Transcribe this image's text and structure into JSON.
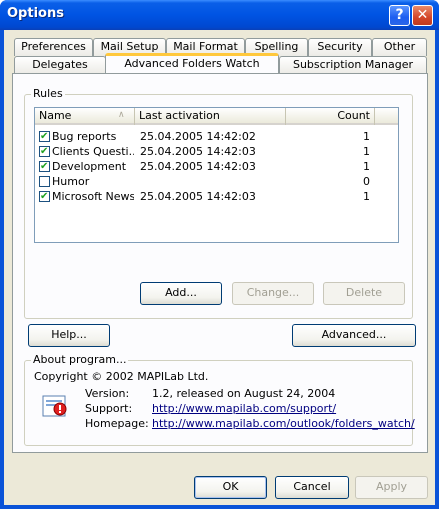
{
  "window": {
    "title": "Options"
  },
  "tabs_row1": [
    "Preferences",
    "Mail Setup",
    "Mail Format",
    "Spelling",
    "Security",
    "Other"
  ],
  "tabs_row2": [
    "Delegates",
    "Advanced Folders Watch",
    "Subscription Manager"
  ],
  "selected_tab": "Advanced Folders Watch",
  "rules": {
    "group_label": "Rules",
    "columns": {
      "name": "Name",
      "last_activation": "Last activation",
      "count": "Count"
    },
    "rows": [
      {
        "checked": true,
        "name": "Bug reports",
        "last_activation": "25.04.2005 14:42:02",
        "count": "1"
      },
      {
        "checked": true,
        "name": "Clients Questi...",
        "last_activation": "25.04.2005 14:42:03",
        "count": "1"
      },
      {
        "checked": true,
        "name": "Development",
        "last_activation": "25.04.2005 14:42:03",
        "count": "1"
      },
      {
        "checked": false,
        "name": "Humor",
        "last_activation": "",
        "count": "0"
      },
      {
        "checked": true,
        "name": "Microsoft News",
        "last_activation": "25.04.2005 14:42:03",
        "count": "1"
      }
    ],
    "add_label": "Add...",
    "change_label": "Change...",
    "delete_label": "Delete"
  },
  "help_label": "Help...",
  "advanced_label": "Advanced...",
  "about": {
    "group_label": "About program...",
    "copyright": "Copyright © 2002 MAPILab Ltd.",
    "version_label": "Version:",
    "version_value": "1.2, released on August 24, 2004",
    "support_label": "Support:",
    "support_url": "http://www.mapilab.com/support/",
    "homepage_label": "Homepage:",
    "homepage_url": "http://www.mapilab.com/outlook/folders_watch/"
  },
  "footer": {
    "ok": "OK",
    "cancel": "Cancel",
    "apply": "Apply"
  }
}
